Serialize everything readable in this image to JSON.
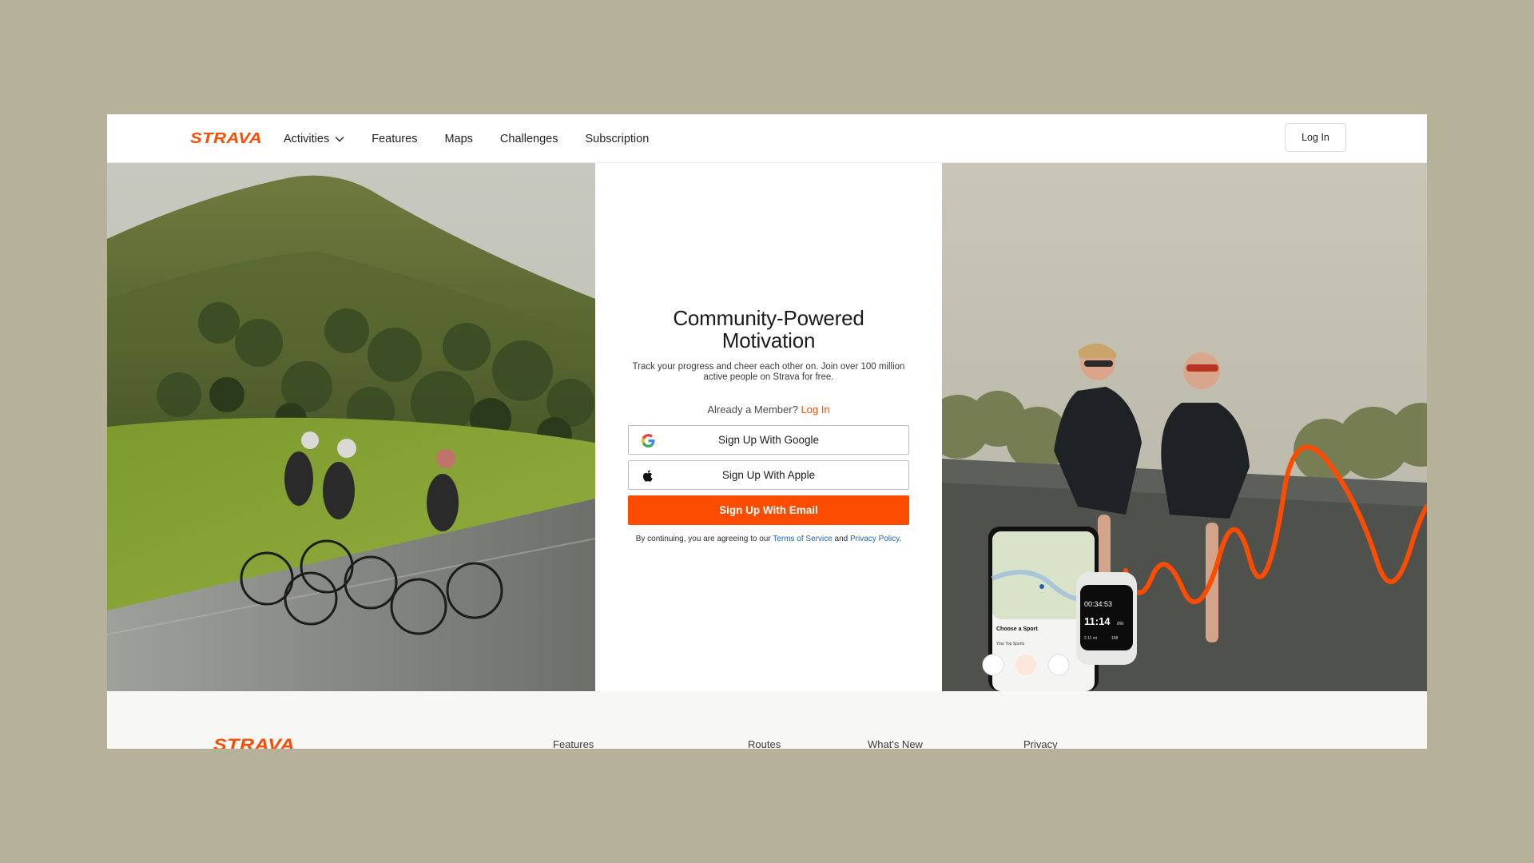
{
  "header": {
    "logo": "STRAVA",
    "nav": [
      {
        "label": "Activities",
        "has_dropdown": true
      },
      {
        "label": "Features"
      },
      {
        "label": "Maps"
      },
      {
        "label": "Challenges"
      },
      {
        "label": "Subscription"
      }
    ],
    "login_label": "Log In"
  },
  "signup": {
    "title": "Community-Powered Motivation",
    "subtitle": "Track your progress and cheer each other on. Join over 100 million active people on Strava for free.",
    "member_text": "Already a Member?",
    "member_link": "Log In",
    "google_label": "Sign Up With Google",
    "apple_label": "Sign Up With Apple",
    "email_label": "Sign Up With Email",
    "terms_prefix": "By continuing, you are agreeing to our",
    "terms_link": "Terms of Service",
    "terms_and": "and",
    "privacy_link": "Privacy Policy",
    "terms_suffix": "."
  },
  "watch": {
    "elapsed": "00:34:53",
    "pace": "11:14",
    "pace_unit": "/mi",
    "distance": "2.11 mi",
    "heart_rate": "158"
  },
  "phone": {
    "heading": "Choose a Sport",
    "subheading": "Your Top Sports"
  },
  "footer": {
    "logo": "STRAVA",
    "links": [
      "Features",
      "Routes",
      "What's New",
      "Privacy"
    ]
  },
  "colors": {
    "brand": "#fc4c02",
    "link": "#1e63b8",
    "backdrop": "#b6b29a"
  }
}
